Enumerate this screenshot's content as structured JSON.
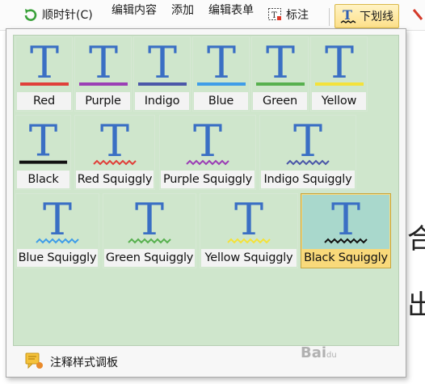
{
  "toolbar": {
    "rotate_label": "顺时针(C)",
    "edit_content_label": "编辑内容",
    "add_label": "添加",
    "edit_form_label": "编辑表单",
    "annotate_label": "标注",
    "underline_label": "下划线"
  },
  "underline_styles": [
    {
      "label": "Red",
      "color": "#e0403a",
      "style": "line"
    },
    {
      "label": "Purple",
      "color": "#9b3fb5",
      "style": "line"
    },
    {
      "label": "Indigo",
      "color": "#4b57a8",
      "style": "line"
    },
    {
      "label": "Blue",
      "color": "#3f9de8",
      "style": "line"
    },
    {
      "label": "Green",
      "color": "#57b04e",
      "style": "line"
    },
    {
      "label": "Yellow",
      "color": "#f4e23a",
      "style": "line"
    },
    {
      "label": "Black",
      "color": "#111111",
      "style": "line"
    },
    {
      "label": "Red Squiggly",
      "color": "#e0403a",
      "style": "squiggly"
    },
    {
      "label": "Purple Squiggly",
      "color": "#9b3fb5",
      "style": "squiggly"
    },
    {
      "label": "Indigo Squiggly",
      "color": "#4b57a8",
      "style": "squiggly"
    },
    {
      "label": "Blue Squiggly",
      "color": "#3f9de8",
      "style": "squiggly"
    },
    {
      "label": "Green Squiggly",
      "color": "#57b04e",
      "style": "squiggly"
    },
    {
      "label": "Yellow Squiggly",
      "color": "#f4e23a",
      "style": "squiggly"
    },
    {
      "label": "Black Squiggly",
      "color": "#111111",
      "style": "squiggly",
      "selected": true
    }
  ],
  "footer": {
    "annotation_template_label": "注释样式调板"
  },
  "watermark": {
    "text": "Bai",
    "suffix": "du"
  },
  "icons": {
    "rotate": "rotate-clockwise-icon",
    "annotate": "annotation-box-icon",
    "underline": "underline-t-icon",
    "template": "note-palette-icon"
  }
}
